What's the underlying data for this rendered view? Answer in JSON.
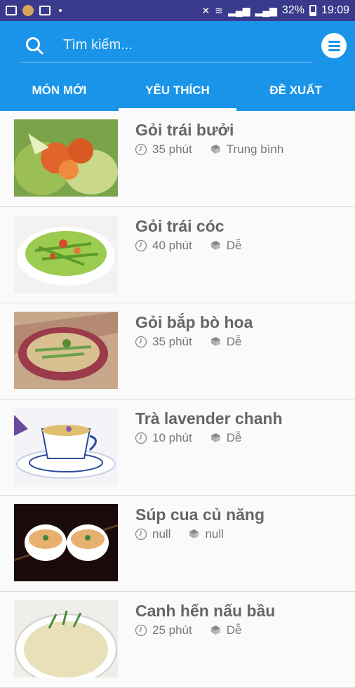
{
  "status_bar": {
    "signal_text": "32%",
    "time": "19:09"
  },
  "search": {
    "placeholder": "Tìm kiếm..."
  },
  "tabs": [
    {
      "label": "MÓN MỚI"
    },
    {
      "label": "YÊU THÍCH"
    },
    {
      "label": "ĐỀ XUẤT"
    }
  ],
  "recipes": [
    {
      "title": "Gỏi trái bưởi",
      "time": "35 phút",
      "difficulty": "Trung bình"
    },
    {
      "title": "Gỏi trái cóc",
      "time": "40 phút",
      "difficulty": "Dễ"
    },
    {
      "title": "Gỏi bắp bò hoa",
      "time": "35 phút",
      "difficulty": "Dễ"
    },
    {
      "title": "Trà lavender chanh",
      "time": "10 phút",
      "difficulty": "Dễ"
    },
    {
      "title": "Súp cua củ năng",
      "time": "null",
      "difficulty": "null"
    },
    {
      "title": "Canh hến nấu bầu",
      "time": "25 phút",
      "difficulty": "Dễ"
    }
  ],
  "colors": {
    "header": "#1a94e8",
    "status_bar": "#3a3a8c",
    "title_text": "#666666"
  },
  "icons": {
    "search": "search-icon",
    "menu": "menu-icon",
    "time": "clock-icon",
    "difficulty": "book-icon"
  }
}
